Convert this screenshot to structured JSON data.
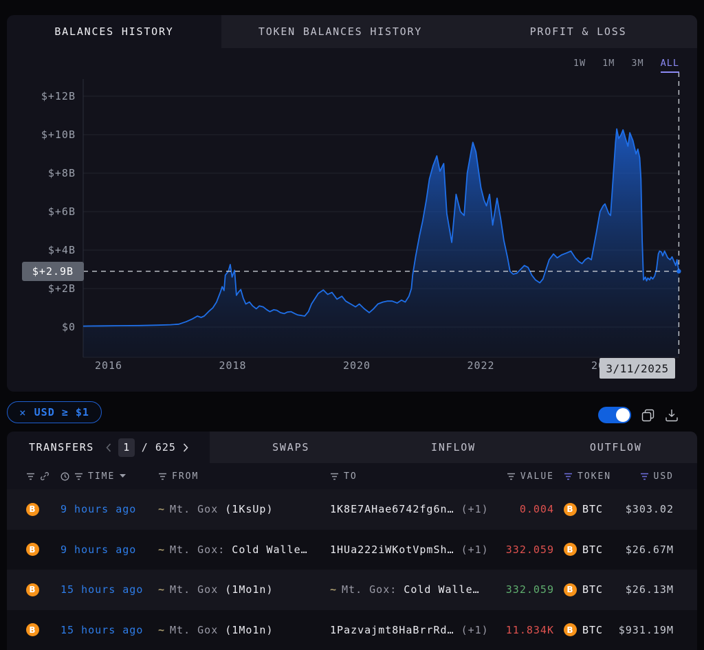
{
  "tabs_top": {
    "items": [
      {
        "label": "BALANCES HISTORY",
        "active": true
      },
      {
        "label": "TOKEN BALANCES HISTORY",
        "active": false
      },
      {
        "label": "PROFIT & LOSS",
        "active": false
      }
    ]
  },
  "chart": {
    "range_buttons": [
      {
        "label": "1W",
        "active": false
      },
      {
        "label": "1M",
        "active": false
      },
      {
        "label": "3M",
        "active": false
      },
      {
        "label": "ALL",
        "active": true
      }
    ],
    "y_tick_labels": [
      "$+12B",
      "$+10B",
      "$+8B",
      "$+6B",
      "$+4B",
      "$+2B",
      "$0"
    ],
    "x_tick_labels": [
      "2016",
      "2018",
      "2020",
      "2022",
      "2024"
    ],
    "x_tick_years": [
      2016,
      2018,
      2020,
      2022,
      2024
    ],
    "crosshair_value": "$+2.9B",
    "crosshair_date": "3/11/2025"
  },
  "chart_data": {
    "type": "area",
    "series_name": "Balance (USD, billions)",
    "x_unit": "year (decimal)",
    "ylim_billions": [
      0,
      13
    ],
    "y_gridlines_billions": [
      0,
      2,
      4,
      6,
      8,
      10,
      12
    ],
    "crosshair_value_billions": 2.9,
    "crosshair_x_year": 2025.19,
    "line_color": "#1f6fe8",
    "points": [
      [
        2015.59,
        0.05
      ],
      [
        2015.9,
        0.06
      ],
      [
        2016.2,
        0.07
      ],
      [
        2016.5,
        0.08
      ],
      [
        2016.8,
        0.1
      ],
      [
        2017.0,
        0.12
      ],
      [
        2017.13,
        0.15
      ],
      [
        2017.25,
        0.28
      ],
      [
        2017.35,
        0.42
      ],
      [
        2017.43,
        0.57
      ],
      [
        2017.49,
        0.5
      ],
      [
        2017.54,
        0.57
      ],
      [
        2017.61,
        0.8
      ],
      [
        2017.68,
        1.0
      ],
      [
        2017.74,
        1.3
      ],
      [
        2017.8,
        1.8
      ],
      [
        2017.83,
        2.1
      ],
      [
        2017.86,
        1.9
      ],
      [
        2017.88,
        2.7
      ],
      [
        2017.93,
        2.9
      ],
      [
        2017.96,
        3.25
      ],
      [
        2017.99,
        2.6
      ],
      [
        2018.03,
        2.95
      ],
      [
        2018.06,
        1.65
      ],
      [
        2018.09,
        1.8
      ],
      [
        2018.13,
        1.95
      ],
      [
        2018.17,
        1.5
      ],
      [
        2018.21,
        1.2
      ],
      [
        2018.27,
        1.3
      ],
      [
        2018.32,
        1.1
      ],
      [
        2018.38,
        0.95
      ],
      [
        2018.43,
        1.1
      ],
      [
        2018.49,
        1.05
      ],
      [
        2018.55,
        0.9
      ],
      [
        2018.6,
        0.8
      ],
      [
        2018.66,
        0.9
      ],
      [
        2018.71,
        0.87
      ],
      [
        2018.77,
        0.75
      ],
      [
        2018.83,
        0.7
      ],
      [
        2018.88,
        0.78
      ],
      [
        2018.94,
        0.8
      ],
      [
        2019.0,
        0.7
      ],
      [
        2019.05,
        0.63
      ],
      [
        2019.11,
        0.6
      ],
      [
        2019.16,
        0.57
      ],
      [
        2019.22,
        0.8
      ],
      [
        2019.27,
        1.2
      ],
      [
        2019.33,
        1.5
      ],
      [
        2019.38,
        1.75
      ],
      [
        2019.46,
        1.93
      ],
      [
        2019.53,
        1.7
      ],
      [
        2019.6,
        1.8
      ],
      [
        2019.68,
        1.45
      ],
      [
        2019.76,
        1.6
      ],
      [
        2019.82,
        1.35
      ],
      [
        2019.9,
        1.2
      ],
      [
        2019.98,
        1.05
      ],
      [
        2020.04,
        1.2
      ],
      [
        2020.12,
        0.95
      ],
      [
        2020.2,
        0.75
      ],
      [
        2020.27,
        0.95
      ],
      [
        2020.34,
        1.2
      ],
      [
        2020.42,
        1.3
      ],
      [
        2020.49,
        1.35
      ],
      [
        2020.57,
        1.35
      ],
      [
        2020.65,
        1.25
      ],
      [
        2020.72,
        1.4
      ],
      [
        2020.78,
        1.3
      ],
      [
        2020.84,
        1.6
      ],
      [
        2020.88,
        2.0
      ],
      [
        2020.9,
        2.7
      ],
      [
        2020.95,
        3.7
      ],
      [
        2021.01,
        4.75
      ],
      [
        2021.06,
        5.5
      ],
      [
        2021.12,
        6.6
      ],
      [
        2021.17,
        7.7
      ],
      [
        2021.23,
        8.4
      ],
      [
        2021.29,
        8.9
      ],
      [
        2021.34,
        8.1
      ],
      [
        2021.4,
        8.5
      ],
      [
        2021.45,
        5.9
      ],
      [
        2021.53,
        4.4
      ],
      [
        2021.6,
        6.9
      ],
      [
        2021.67,
        6.0
      ],
      [
        2021.73,
        5.8
      ],
      [
        2021.78,
        8.0
      ],
      [
        2021.84,
        9.1
      ],
      [
        2021.87,
        9.6
      ],
      [
        2021.92,
        9.1
      ],
      [
        2021.95,
        8.4
      ],
      [
        2022.0,
        7.25
      ],
      [
        2022.05,
        6.6
      ],
      [
        2022.09,
        6.3
      ],
      [
        2022.14,
        6.9
      ],
      [
        2022.19,
        5.3
      ],
      [
        2022.26,
        6.7
      ],
      [
        2022.32,
        5.6
      ],
      [
        2022.37,
        4.5
      ],
      [
        2022.43,
        3.6
      ],
      [
        2022.47,
        2.9
      ],
      [
        2022.52,
        2.75
      ],
      [
        2022.58,
        2.8
      ],
      [
        2022.64,
        3.0
      ],
      [
        2022.7,
        3.2
      ],
      [
        2022.76,
        3.1
      ],
      [
        2022.82,
        2.7
      ],
      [
        2022.88,
        2.45
      ],
      [
        2022.95,
        2.3
      ],
      [
        2023.0,
        2.5
      ],
      [
        2023.05,
        3.0
      ],
      [
        2023.1,
        3.5
      ],
      [
        2023.17,
        3.8
      ],
      [
        2023.23,
        3.6
      ],
      [
        2023.3,
        3.75
      ],
      [
        2023.38,
        3.85
      ],
      [
        2023.45,
        3.95
      ],
      [
        2023.52,
        3.6
      ],
      [
        2023.58,
        3.4
      ],
      [
        2023.63,
        3.3
      ],
      [
        2023.68,
        3.5
      ],
      [
        2023.73,
        3.6
      ],
      [
        2023.78,
        3.5
      ],
      [
        2023.86,
        4.9
      ],
      [
        2023.92,
        6.0
      ],
      [
        2023.97,
        6.3
      ],
      [
        2024.0,
        6.4
      ],
      [
        2024.06,
        5.9
      ],
      [
        2024.09,
        5.8
      ],
      [
        2024.13,
        7.7
      ],
      [
        2024.17,
        9.6
      ],
      [
        2024.19,
        10.3
      ],
      [
        2024.22,
        9.8
      ],
      [
        2024.26,
        10.0
      ],
      [
        2024.29,
        10.25
      ],
      [
        2024.34,
        9.7
      ],
      [
        2024.37,
        9.4
      ],
      [
        2024.4,
        10.1
      ],
      [
        2024.45,
        9.7
      ],
      [
        2024.5,
        9.0
      ],
      [
        2024.53,
        9.25
      ],
      [
        2024.56,
        8.8
      ],
      [
        2024.58,
        7.7
      ],
      [
        2024.6,
        4.5
      ],
      [
        2024.62,
        2.45
      ],
      [
        2024.65,
        2.6
      ],
      [
        2024.67,
        2.4
      ],
      [
        2024.69,
        2.55
      ],
      [
        2024.72,
        2.45
      ],
      [
        2024.74,
        2.6
      ],
      [
        2024.77,
        2.5
      ],
      [
        2024.8,
        2.65
      ],
      [
        2024.83,
        3.0
      ],
      [
        2024.86,
        3.8
      ],
      [
        2024.88,
        3.95
      ],
      [
        2024.91,
        3.9
      ],
      [
        2024.93,
        3.7
      ],
      [
        2024.96,
        3.95
      ],
      [
        2024.99,
        3.75
      ],
      [
        2025.01,
        3.6
      ],
      [
        2025.05,
        3.5
      ],
      [
        2025.08,
        3.65
      ],
      [
        2025.1,
        3.5
      ],
      [
        2025.14,
        3.2
      ],
      [
        2025.16,
        3.5
      ],
      [
        2025.19,
        2.9
      ]
    ]
  },
  "filter_chip": {
    "close_icon": "×",
    "label": "USD ≥ $1"
  },
  "controls": {
    "toggle_on": true,
    "icons": [
      "copy",
      "download"
    ]
  },
  "transfers": {
    "title": "TRANSFERS",
    "pagination": {
      "current_page": "1",
      "separator": "/",
      "total_pages": "625"
    },
    "tabs": [
      {
        "label": "SWAPS"
      },
      {
        "label": "INFLOW"
      },
      {
        "label": "OUTFLOW"
      }
    ],
    "header": {
      "time": "TIME",
      "from": "FROM",
      "to": "TO",
      "value": "VALUE",
      "token": "TOKEN",
      "usd": "USD"
    },
    "rows": [
      {
        "asset_icon": "bitcoin",
        "time": "9 hours ago",
        "from": {
          "type": "entity",
          "entity": "Mt. Gox",
          "label": "(1KsUp)"
        },
        "to": {
          "type": "address",
          "address": "1K8E7AHae6742fg6n…",
          "extra": "(+1)"
        },
        "value": {
          "amount": "0.004",
          "direction": "out"
        },
        "token": "BTC",
        "usd": "$303.02"
      },
      {
        "asset_icon": "bitcoin",
        "time": "9 hours ago",
        "from": {
          "type": "entity",
          "entity": "Mt. Gox:",
          "label": "Cold Walle…"
        },
        "to": {
          "type": "address",
          "address": "1HUa222iWKotVpmSh…",
          "extra": "(+1)"
        },
        "value": {
          "amount": "332.059",
          "direction": "out"
        },
        "token": "BTC",
        "usd": "$26.67M"
      },
      {
        "asset_icon": "bitcoin",
        "time": "15 hours ago",
        "from": {
          "type": "entity",
          "entity": "Mt. Gox",
          "label": "(1Mo1n)"
        },
        "to": {
          "type": "entity",
          "entity": "Mt. Gox:",
          "label": "Cold Walle…"
        },
        "value": {
          "amount": "332.059",
          "direction": "in"
        },
        "token": "BTC",
        "usd": "$26.13M"
      },
      {
        "asset_icon": "bitcoin",
        "time": "15 hours ago",
        "from": {
          "type": "entity",
          "entity": "Mt. Gox",
          "label": "(1Mo1n)"
        },
        "to": {
          "type": "address",
          "address": "1Pazvajmt8HaBrrRd…",
          "extra": "(+1)"
        },
        "value": {
          "amount": "11.834K",
          "direction": "out"
        },
        "token": "BTC",
        "usd": "$931.19M"
      }
    ]
  },
  "colors": {
    "accent_blue": "#2e7de9",
    "value_out_red": "#e0524f",
    "value_in_green": "#5fae6e",
    "bitcoin_orange": "#f7931a",
    "range_active_purple": "#8c8af5",
    "panel_bg": "#12121b",
    "tabstrip_bg": "#1c1c25",
    "crosshair_label_bg": "#5d626d",
    "date_label_bg": "#c2c5cb"
  }
}
